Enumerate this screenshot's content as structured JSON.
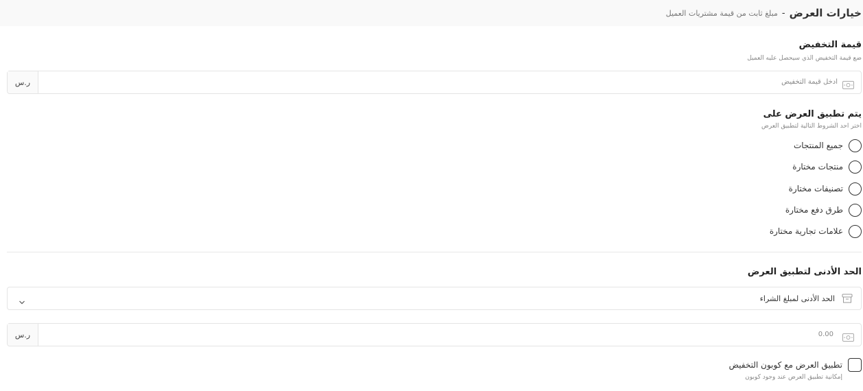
{
  "header": {
    "title": "خيارات العرض",
    "separator": "-",
    "subtitle": "مبلغ ثابت من قيمة مشتريات العميل"
  },
  "discount": {
    "title": "قيمة التخفيض",
    "description": "ضع قيمة التخفيض الذي سيحصل عليه العميل",
    "placeholder": "ادخل قيمة التخفيض",
    "currency": "ر.س",
    "icon": "money-icon"
  },
  "apply_on": {
    "title": "يتم تطبيق العرض على",
    "description": "اختر احد الشروط التالية لتطبيق العرض",
    "options": [
      {
        "label": "جميع المنتجات"
      },
      {
        "label": "منتجات مختارة"
      },
      {
        "label": "تصنيفات مختارة"
      },
      {
        "label": "طرق دفع مختارة"
      },
      {
        "label": "علامات تجارية مختارة"
      }
    ]
  },
  "minimum": {
    "title": "الحد الأدنى لتطبيق العرض",
    "select_value": "الحد الأدنى لمبلغ الشراء",
    "select_icon": "archive-icon",
    "amount_value": "0.00",
    "amount_currency": "ر.س",
    "amount_icon": "money-icon"
  },
  "coupon": {
    "label": "تطبيق العرض مع كوبون التخفيض",
    "description": "إمكانية تطبيق العرض عند وجود كوبون"
  }
}
